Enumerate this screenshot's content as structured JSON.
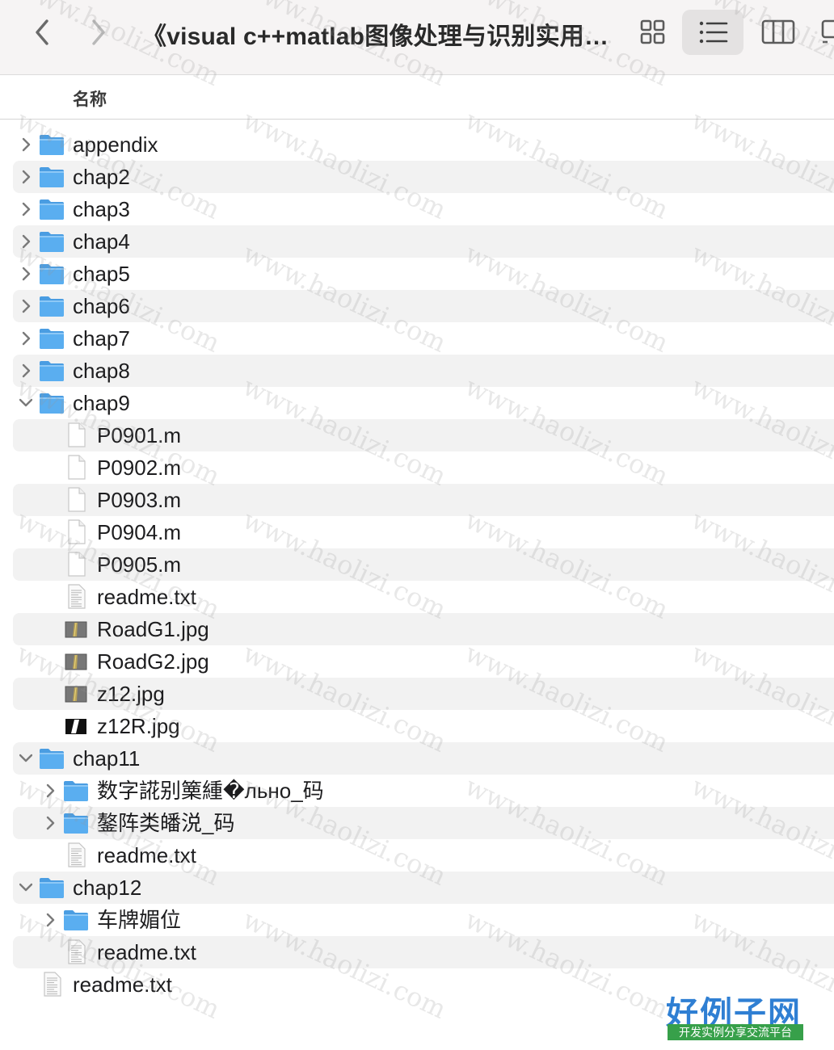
{
  "window": {
    "title": "《visual c++matlab图像处理与识别实用…"
  },
  "toolbar": {
    "back_icon": "chevron-left-icon",
    "forward_icon": "chevron-right-icon",
    "view_modes": [
      "icon-view",
      "list-view",
      "column-view",
      "gallery-view"
    ],
    "active_view": "list-view"
  },
  "column_header": {
    "name": "名称"
  },
  "rows": [
    {
      "name": "appendix",
      "type": "folder",
      "level": 0,
      "expanded": false
    },
    {
      "name": "chap2",
      "type": "folder",
      "level": 0,
      "expanded": false
    },
    {
      "name": "chap3",
      "type": "folder",
      "level": 0,
      "expanded": false
    },
    {
      "name": "chap4",
      "type": "folder",
      "level": 0,
      "expanded": false
    },
    {
      "name": "chap5",
      "type": "folder",
      "level": 0,
      "expanded": false
    },
    {
      "name": "chap6",
      "type": "folder",
      "level": 0,
      "expanded": false
    },
    {
      "name": "chap7",
      "type": "folder",
      "level": 0,
      "expanded": false
    },
    {
      "name": "chap8",
      "type": "folder",
      "level": 0,
      "expanded": false
    },
    {
      "name": "chap9",
      "type": "folder",
      "level": 0,
      "expanded": true
    },
    {
      "name": "P0901.m",
      "type": "file",
      "level": 1
    },
    {
      "name": "P0902.m",
      "type": "file",
      "level": 1
    },
    {
      "name": "P0903.m",
      "type": "file",
      "level": 1
    },
    {
      "name": "P0904.m",
      "type": "file",
      "level": 1
    },
    {
      "name": "P0905.m",
      "type": "file",
      "level": 1
    },
    {
      "name": "readme.txt",
      "type": "text",
      "level": 1
    },
    {
      "name": "RoadG1.jpg",
      "type": "image",
      "level": 1
    },
    {
      "name": "RoadG2.jpg",
      "type": "image",
      "level": 1
    },
    {
      "name": "z12.jpg",
      "type": "image",
      "level": 1
    },
    {
      "name": "z12R.jpg",
      "type": "image-bw",
      "level": 1
    },
    {
      "name": "chap11",
      "type": "folder",
      "level": 0,
      "expanded": true
    },
    {
      "name": "数字誮别篥緟�льно_码",
      "type": "folder",
      "level": 1,
      "expanded": false
    },
    {
      "name": "鏊阵类皤涚_码",
      "type": "folder",
      "level": 1,
      "expanded": false
    },
    {
      "name": "readme.txt",
      "type": "text",
      "level": 1
    },
    {
      "name": "chap12",
      "type": "folder",
      "level": 0,
      "expanded": true
    },
    {
      "name": "车牌媚位",
      "type": "folder",
      "level": 1,
      "expanded": false
    },
    {
      "name": "readme.txt",
      "type": "text",
      "level": 1
    },
    {
      "name": "readme.txt",
      "type": "text",
      "level": 0
    }
  ],
  "watermark": {
    "text": "www.haolizi.com",
    "logo_main": "好例子网",
    "logo_sub": "开发实例分享交流平台"
  },
  "colors": {
    "folder": "#5aaef0",
    "folder_tab": "#4a9de2",
    "toolbar_bg": "#f6f4f4",
    "alt_row": "#f2f2f2",
    "logo_blue": "#2f7fd3",
    "logo_green": "#37a04a"
  }
}
